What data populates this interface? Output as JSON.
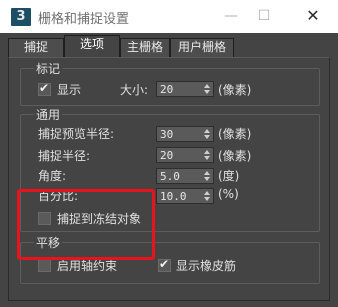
{
  "window": {
    "app_icon_text": "3",
    "title": "栅格和捕捉设置",
    "minimize_glyph": "—",
    "maximize_glyph": "☐",
    "close_glyph": "✕"
  },
  "tabs": [
    {
      "label": "捕捉"
    },
    {
      "label": "选项"
    },
    {
      "label": "主栅格"
    },
    {
      "label": "用户栅格"
    }
  ],
  "active_tab": "选项",
  "marker": {
    "title": "标记",
    "display_label": "显示",
    "display_checked": true,
    "size_label": "大小:",
    "size_value": "20",
    "size_unit": "(像素)"
  },
  "general": {
    "title": "通用",
    "preview_radius_label": "捕捉预览半径:",
    "preview_radius_value": "30",
    "preview_radius_unit": "(像素)",
    "snap_radius_label": "捕捉半径:",
    "snap_radius_value": "20",
    "snap_radius_unit": "(像素)",
    "angle_label": "角度:",
    "angle_value": "5.0",
    "angle_unit": "(度)",
    "percent_label": "百分比:",
    "percent_value": "10.0",
    "percent_unit": "(%)",
    "snap_frozen_label": "捕捉到冻结对象",
    "snap_frozen_checked": false
  },
  "translation": {
    "title": "平移",
    "axis_constraint_label": "启用轴约束",
    "axis_constraint_checked": false,
    "rubber_band_label": "显示橡皮筋",
    "rubber_band_checked": true
  },
  "colors": {
    "background": "#444444",
    "highlight": "#e8141c",
    "field": "#5a5a5a"
  },
  "icons": {
    "spinner": "up-down-arrows-icon",
    "check": "checkmark-icon"
  }
}
